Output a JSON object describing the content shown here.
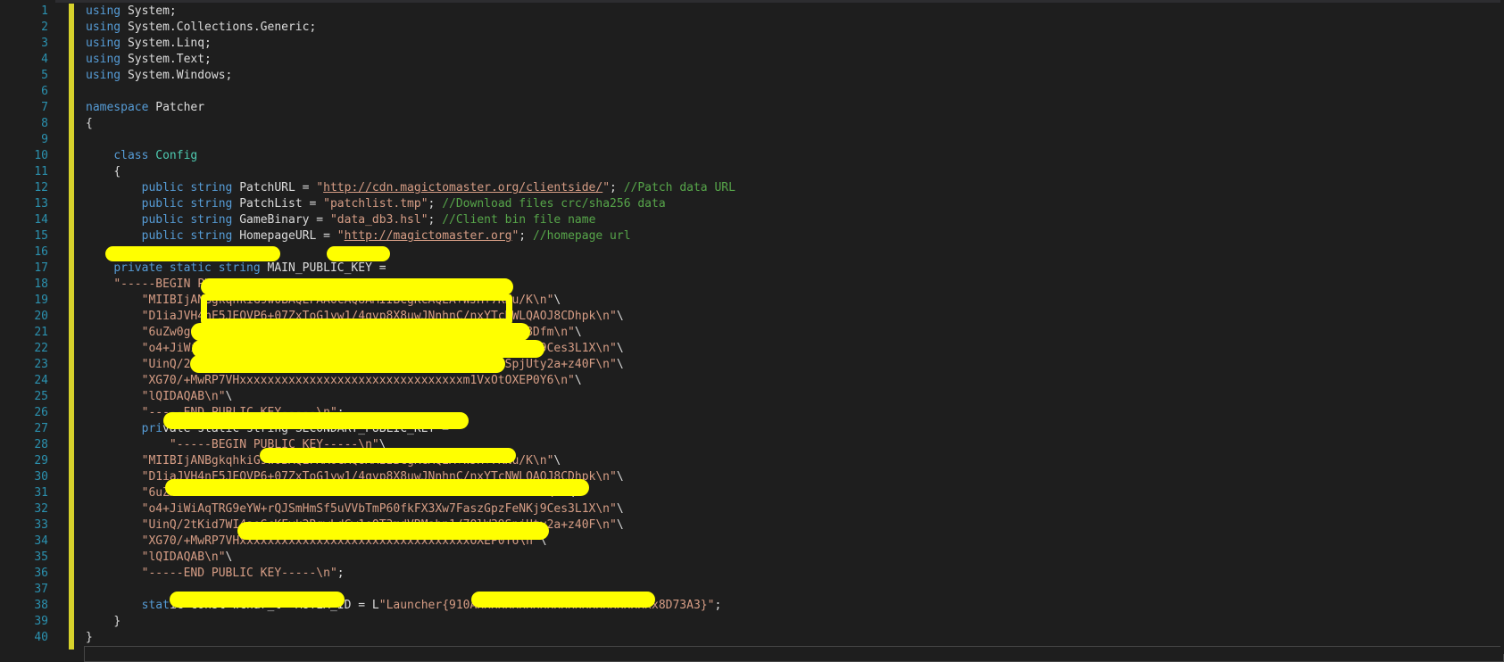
{
  "editor": {
    "line_numbers": [
      "1",
      "2",
      "3",
      "4",
      "5",
      "6",
      "7",
      "8",
      "9",
      "10",
      "11",
      "12",
      "13",
      "14",
      "15",
      "16",
      "17",
      "18",
      "19",
      "20",
      "21",
      "22",
      "23",
      "24",
      "25",
      "26",
      "27",
      "28",
      "29",
      "30",
      "31",
      "32",
      "33",
      "34",
      "35",
      "36",
      "37",
      "38",
      "39",
      "40"
    ],
    "lines": [
      {
        "indent": "",
        "parts": [
          {
            "t": "kw",
            "v": "using"
          },
          {
            "t": "plain",
            "v": " System;"
          }
        ]
      },
      {
        "indent": "",
        "parts": [
          {
            "t": "kw",
            "v": "using"
          },
          {
            "t": "plain",
            "v": " System.Collections.Generic;"
          }
        ]
      },
      {
        "indent": "",
        "parts": [
          {
            "t": "kw",
            "v": "using"
          },
          {
            "t": "plain",
            "v": " System.Linq;"
          }
        ]
      },
      {
        "indent": "",
        "parts": [
          {
            "t": "kw",
            "v": "using"
          },
          {
            "t": "plain",
            "v": " System.Text;"
          }
        ]
      },
      {
        "indent": "",
        "parts": [
          {
            "t": "kw",
            "v": "using"
          },
          {
            "t": "plain",
            "v": " System.Windows;"
          }
        ]
      },
      {
        "indent": "",
        "parts": []
      },
      {
        "indent": "",
        "parts": [
          {
            "t": "kw",
            "v": "namespace"
          },
          {
            "t": "plain",
            "v": " Patcher"
          }
        ]
      },
      {
        "indent": "",
        "parts": [
          {
            "t": "plain",
            "v": "{"
          }
        ]
      },
      {
        "indent": "",
        "parts": []
      },
      {
        "indent": "    ",
        "parts": [
          {
            "t": "kw",
            "v": "class"
          },
          {
            "t": "plain",
            "v": " "
          },
          {
            "t": "ty",
            "v": "Config"
          }
        ]
      },
      {
        "indent": "    ",
        "parts": [
          {
            "t": "plain",
            "v": "{"
          }
        ]
      },
      {
        "indent": "        ",
        "parts": [
          {
            "t": "kw",
            "v": "public"
          },
          {
            "t": "plain",
            "v": " "
          },
          {
            "t": "kw",
            "v": "string"
          },
          {
            "t": "plain",
            "v": " PatchURL = "
          },
          {
            "t": "str",
            "v": "\""
          },
          {
            "t": "url",
            "v": "http://cdn.magictomaster.org/clientside/"
          },
          {
            "t": "str",
            "v": "\""
          },
          {
            "t": "plain",
            "v": "; "
          },
          {
            "t": "cmt",
            "v": "//Patch data URL"
          }
        ]
      },
      {
        "indent": "        ",
        "parts": [
          {
            "t": "kw",
            "v": "public"
          },
          {
            "t": "plain",
            "v": " "
          },
          {
            "t": "kw",
            "v": "string"
          },
          {
            "t": "plain",
            "v": " PatchList = "
          },
          {
            "t": "str",
            "v": "\"patchlist.tmp\""
          },
          {
            "t": "plain",
            "v": "; "
          },
          {
            "t": "cmt",
            "v": "//Download files crc/sha256 data"
          }
        ]
      },
      {
        "indent": "        ",
        "parts": [
          {
            "t": "kw",
            "v": "public"
          },
          {
            "t": "plain",
            "v": " "
          },
          {
            "t": "kw",
            "v": "string"
          },
          {
            "t": "plain",
            "v": " GameBinary = "
          },
          {
            "t": "str",
            "v": "\"data_db3.hsl\""
          },
          {
            "t": "plain",
            "v": "; "
          },
          {
            "t": "cmt",
            "v": "//Client bin file name"
          }
        ]
      },
      {
        "indent": "        ",
        "parts": [
          {
            "t": "kw",
            "v": "public"
          },
          {
            "t": "plain",
            "v": " "
          },
          {
            "t": "kw",
            "v": "string"
          },
          {
            "t": "plain",
            "v": " HomepageURL = "
          },
          {
            "t": "str",
            "v": "\""
          },
          {
            "t": "url",
            "v": "http://magictomaster.org"
          },
          {
            "t": "str",
            "v": "\""
          },
          {
            "t": "plain",
            "v": "; "
          },
          {
            "t": "cmt",
            "v": "//homepage url"
          }
        ]
      },
      {
        "indent": "",
        "parts": []
      },
      {
        "indent": "    ",
        "parts": [
          {
            "t": "kw",
            "v": "private static string"
          },
          {
            "t": "plain",
            "v": " MAIN_PUBLIC_KEY ="
          }
        ]
      },
      {
        "indent": "    ",
        "parts": [
          {
            "t": "str",
            "v": "\"-----BEGIN PUBLIC KEY-----\\n\""
          },
          {
            "t": "plain",
            "v": "\\"
          }
        ]
      },
      {
        "indent": "        ",
        "parts": [
          {
            "t": "str",
            "v": "\"MIIBIjANBgkqhkiG9w0BAQEFAAOCAQ8AMIIBCgKCAQEA+WJH+7KNu/K\\n\""
          },
          {
            "t": "plain",
            "v": "\\"
          }
        ]
      },
      {
        "indent": "        ",
        "parts": [
          {
            "t": "str",
            "v": "\"D1iaJVH4nF5JEOVP6+07ZxToG1yw1/4qvp8X8uwJNnhnC/nxYTcNWLQAOJ8CDhpk\\n\""
          },
          {
            "t": "plain",
            "v": "\\"
          }
        ]
      },
      {
        "indent": "        ",
        "parts": [
          {
            "t": "str",
            "v": "\"6uZw0gG9xxxxxxxxxxxxxxxxxxxxxxxxxxxxxxxxxxxxxxxxlqhkYm8Dfm\\n\""
          },
          {
            "t": "plain",
            "v": "\\"
          }
        ]
      },
      {
        "indent": "        ",
        "parts": [
          {
            "t": "str",
            "v": "\"o4+JiWiAqTRG9eYW+rQJSmHmSf5uVVbTmP60fkFX3Xw7FaszGpzFeNKj9Ces3L1X\\n\""
          },
          {
            "t": "plain",
            "v": "\\"
          }
        ]
      },
      {
        "indent": "        ",
        "parts": [
          {
            "t": "str",
            "v": "\"UinQ/2tKid7WI4aoGcKFyk2RgwLdCw1eQT3mdVRMabn1/7OlW39SpjUty2a+z40F\\n\""
          },
          {
            "t": "plain",
            "v": "\\"
          }
        ]
      },
      {
        "indent": "        ",
        "parts": [
          {
            "t": "str",
            "v": "\"XG70/+MwRP7VHxxxxxxxxxxxxxxxxxxxxxxxxxxxxxxxxm1VxOtOXEP0Y6\\n\""
          },
          {
            "t": "plain",
            "v": "\\"
          }
        ]
      },
      {
        "indent": "        ",
        "parts": [
          {
            "t": "str",
            "v": "\"lQIDAQAB\\n\""
          },
          {
            "t": "plain",
            "v": "\\"
          }
        ]
      },
      {
        "indent": "        ",
        "parts": [
          {
            "t": "str",
            "v": "\"-----END PUBLIC KEY-----\\n\""
          },
          {
            "t": "plain",
            "v": ";"
          }
        ]
      },
      {
        "indent": "        ",
        "parts": [
          {
            "t": "kw",
            "v": "pri"
          },
          {
            "t": "plain",
            "v": "vate static string SECONDARY_PUBLIC_KEY ="
          }
        ]
      },
      {
        "indent": "            ",
        "parts": [
          {
            "t": "str",
            "v": "\"-----BEGIN PUBLIC KEY-----\\n\""
          },
          {
            "t": "plain",
            "v": "\\"
          }
        ]
      },
      {
        "indent": "        ",
        "parts": [
          {
            "t": "str",
            "v": "\"MIIBIjANBgkqhkiG9w0BAQEFAAOCAQ8AMIIBCgKCAQEA+WJH+7KNu/K\\n\""
          },
          {
            "t": "plain",
            "v": "\\"
          }
        ]
      },
      {
        "indent": "        ",
        "parts": [
          {
            "t": "str",
            "v": "\"D1iaJVH4nF5JEOVP6+07ZxToG1yw1/4qvp8X8uwJNnhnC/nxYTcNWLQAOJ8CDhpk\\n\""
          },
          {
            "t": "plain",
            "v": "\\"
          }
        ]
      },
      {
        "indent": "        ",
        "parts": [
          {
            "t": "str",
            "v": "\"6uZxxxxxxxxxxxxxxxxxxxxxxxxxxxxxxxxxxxxxxxxxxxxxxxxxxxxxm\\n\""
          },
          {
            "t": "plain",
            "v": "\\"
          }
        ]
      },
      {
        "indent": "        ",
        "parts": [
          {
            "t": "str",
            "v": "\"o4+JiWiAqTRG9eYW+rQJSmHmSf5uVVbTmP60fkFX3Xw7FaszGpzFeNKj9Ces3L1X\\n\""
          },
          {
            "t": "plain",
            "v": "\\"
          }
        ]
      },
      {
        "indent": "        ",
        "parts": [
          {
            "t": "str",
            "v": "\"UinQ/2tKid7WI4aoGcKFyk2RgwLdCw1eQT3mdVRMabn1/7OlW39SpjUty2a+z40F\\n\""
          },
          {
            "t": "plain",
            "v": "\\"
          }
        ]
      },
      {
        "indent": "        ",
        "parts": [
          {
            "t": "str",
            "v": "\"XG70/+MwRP7VHxxxxxxxxxxxxxxxxxxxxxxxxxxxxxxxxxOXEP0Y6\\n\""
          },
          {
            "t": "plain",
            "v": "\\"
          }
        ]
      },
      {
        "indent": "        ",
        "parts": [
          {
            "t": "str",
            "v": "\"lQIDAQAB\\n\""
          },
          {
            "t": "plain",
            "v": "\\"
          }
        ]
      },
      {
        "indent": "        ",
        "parts": [
          {
            "t": "str",
            "v": "\"-----END PUBLIC KEY-----\\n\""
          },
          {
            "t": "plain",
            "v": ";"
          }
        ]
      },
      {
        "indent": "",
        "parts": []
      },
      {
        "indent": "        ",
        "parts": [
          {
            "t": "kw",
            "v": "stat"
          },
          {
            "t": "plain",
            "v": "ic const wchar_t* MUTEX_ID = L"
          },
          {
            "t": "str",
            "v": "\"Launcher{910Axxxxxxxxxxxxxxxxxxxxxxxxxx8D73A3}\""
          },
          {
            "t": "plain",
            "v": ";"
          }
        ]
      },
      {
        "indent": "    ",
        "parts": [
          {
            "t": "plain",
            "v": "}"
          }
        ]
      },
      {
        "indent": "",
        "parts": [
          {
            "t": "plain",
            "v": "}"
          }
        ]
      },
      {
        "indent": "",
        "parts": []
      }
    ]
  },
  "colors": {
    "background": "#1e1e1e",
    "line_number": "#2b91af",
    "keyword": "#569cd6",
    "type": "#4ec9b0",
    "string": "#d69d85",
    "comment": "#57a64a",
    "change_margin": "#d7d22c",
    "redaction": "#ffff00"
  }
}
